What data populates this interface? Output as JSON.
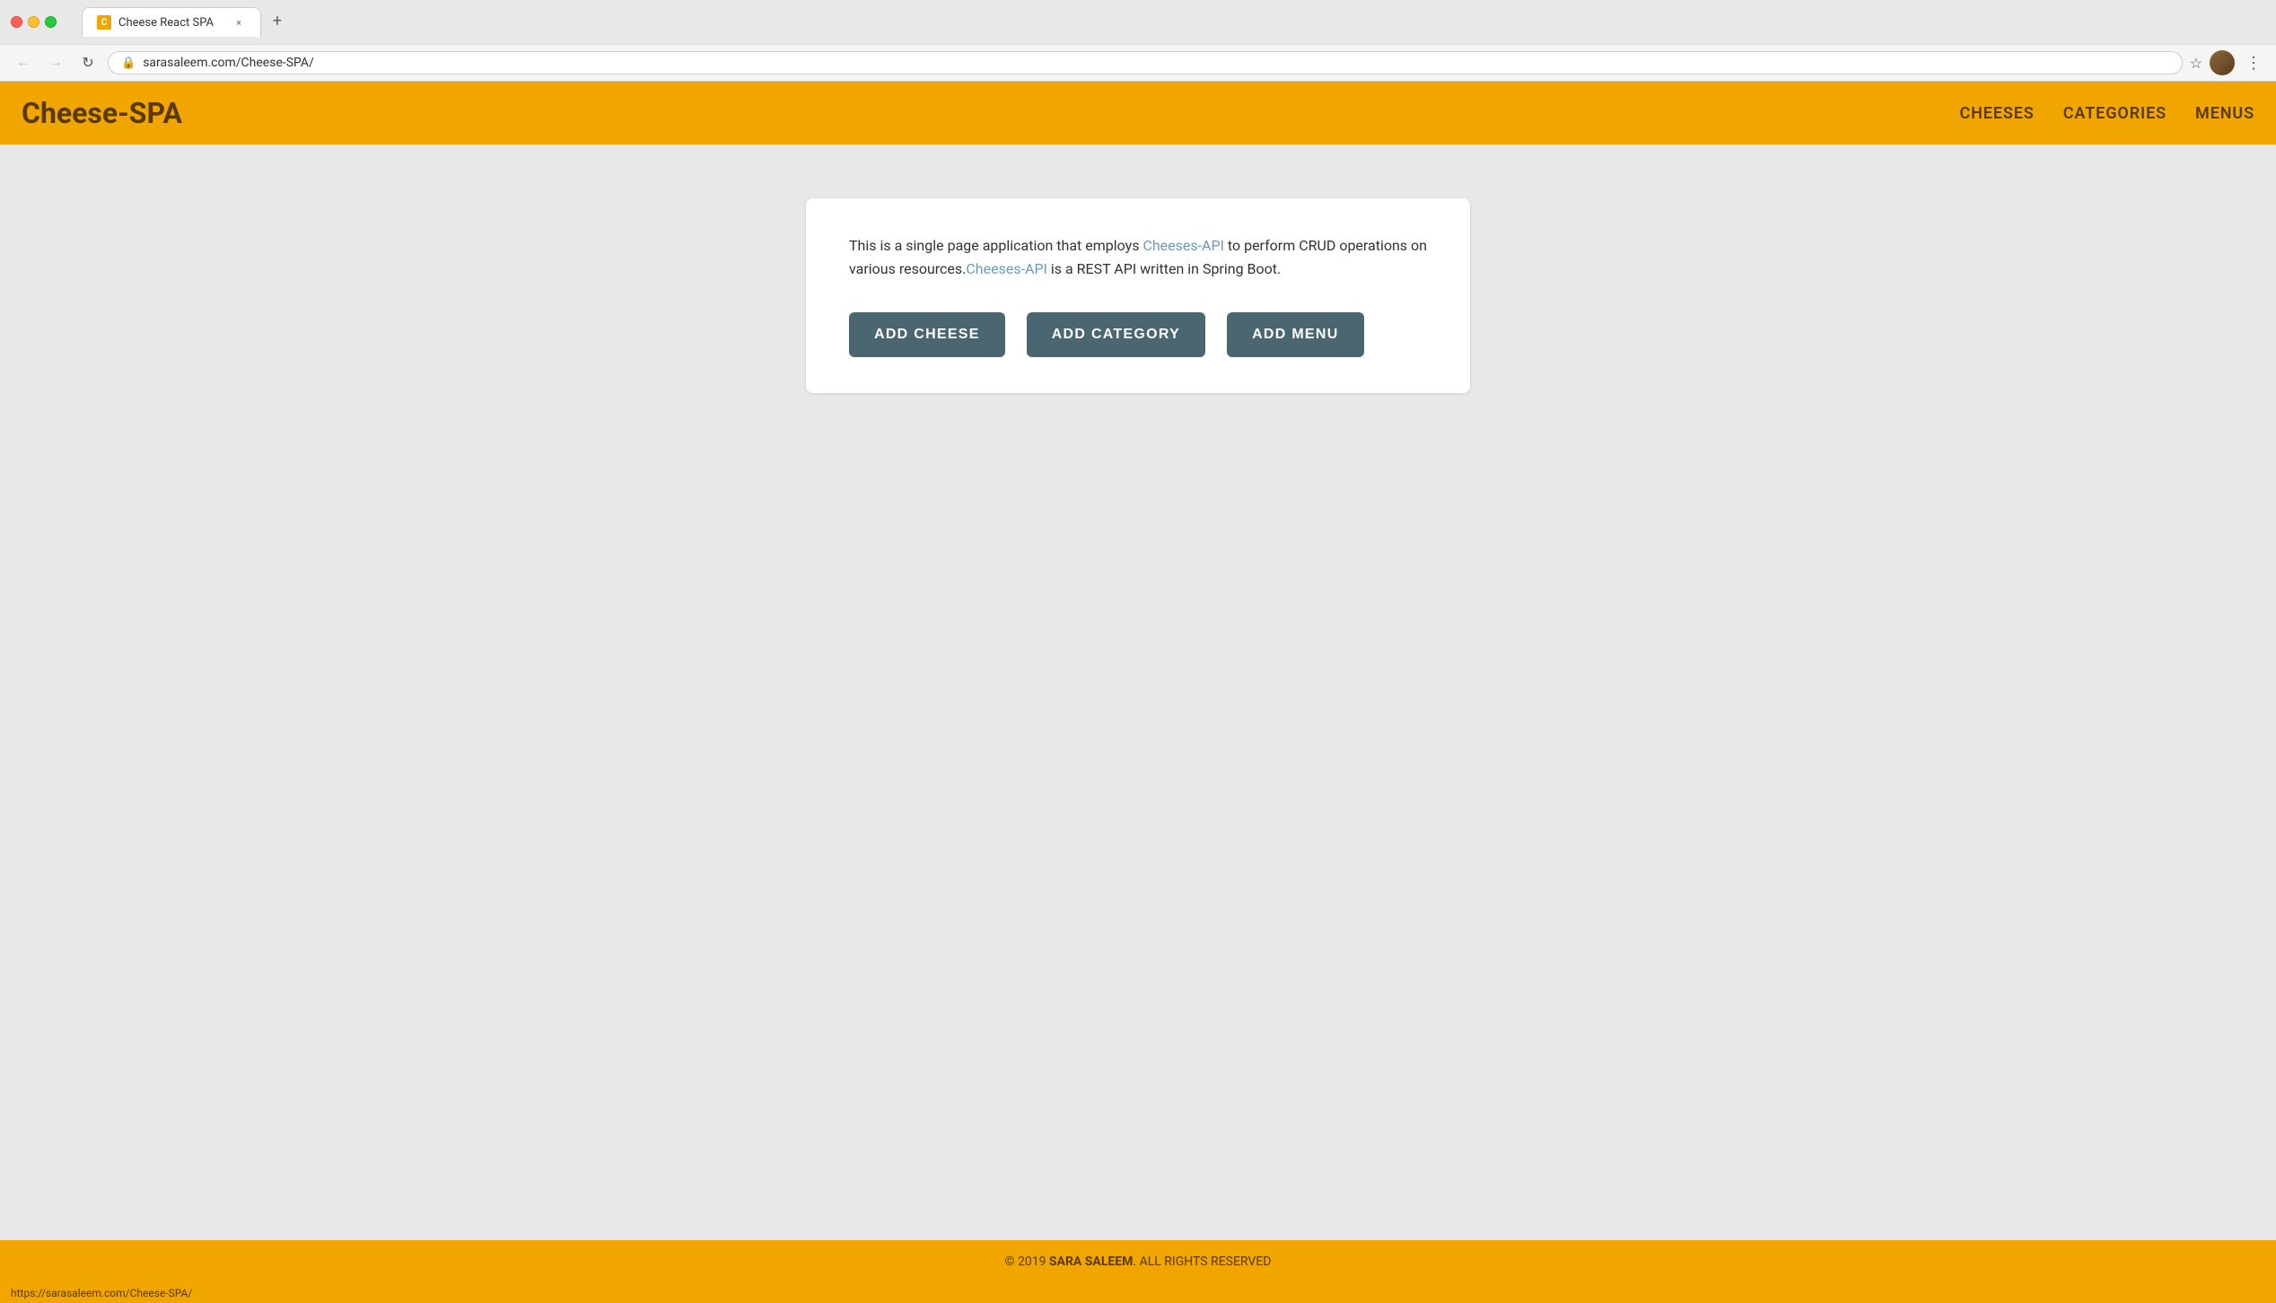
{
  "browser": {
    "tab_title": "Cheese React SPA",
    "tab_favicon": "C",
    "url": "sarasaleem.com/Cheese-SPA/",
    "new_tab_label": "+",
    "close_tab_label": "×",
    "back_label": "←",
    "forward_label": "→",
    "reload_label": "↻",
    "menu_label": "⋮"
  },
  "nav": {
    "brand": "Cheese-SPA",
    "links": [
      {
        "label": "CHEESES",
        "href": "#cheeses"
      },
      {
        "label": "CATEGORIES",
        "href": "#categories"
      },
      {
        "label": "MENUS",
        "href": "#menus"
      }
    ]
  },
  "main": {
    "description_part1": "This is a single page application that employs ",
    "api_link1": "Cheeses-API",
    "description_part2": " to perform CRUD operations on various resources.",
    "api_link2": "Cheeses-API",
    "description_part3": " is a REST API written in Spring Boot.",
    "buttons": [
      {
        "label": "ADD CHEESE"
      },
      {
        "label": "ADD CATEGORY"
      },
      {
        "label": "ADD MENU"
      }
    ]
  },
  "footer": {
    "copyright": "© 2019 ",
    "author": "SARA SALEEM",
    "rights": ". ALL RIGHTS RESERVED"
  },
  "statusbar": {
    "url": "https://sarasaleem.com/Cheese-SPA/"
  },
  "colors": {
    "brand": "#f0a500",
    "brand_dark": "#5a3a00",
    "button": "#4a6670",
    "api_link": "#6b9ab8",
    "bg": "#e8e8e8"
  }
}
